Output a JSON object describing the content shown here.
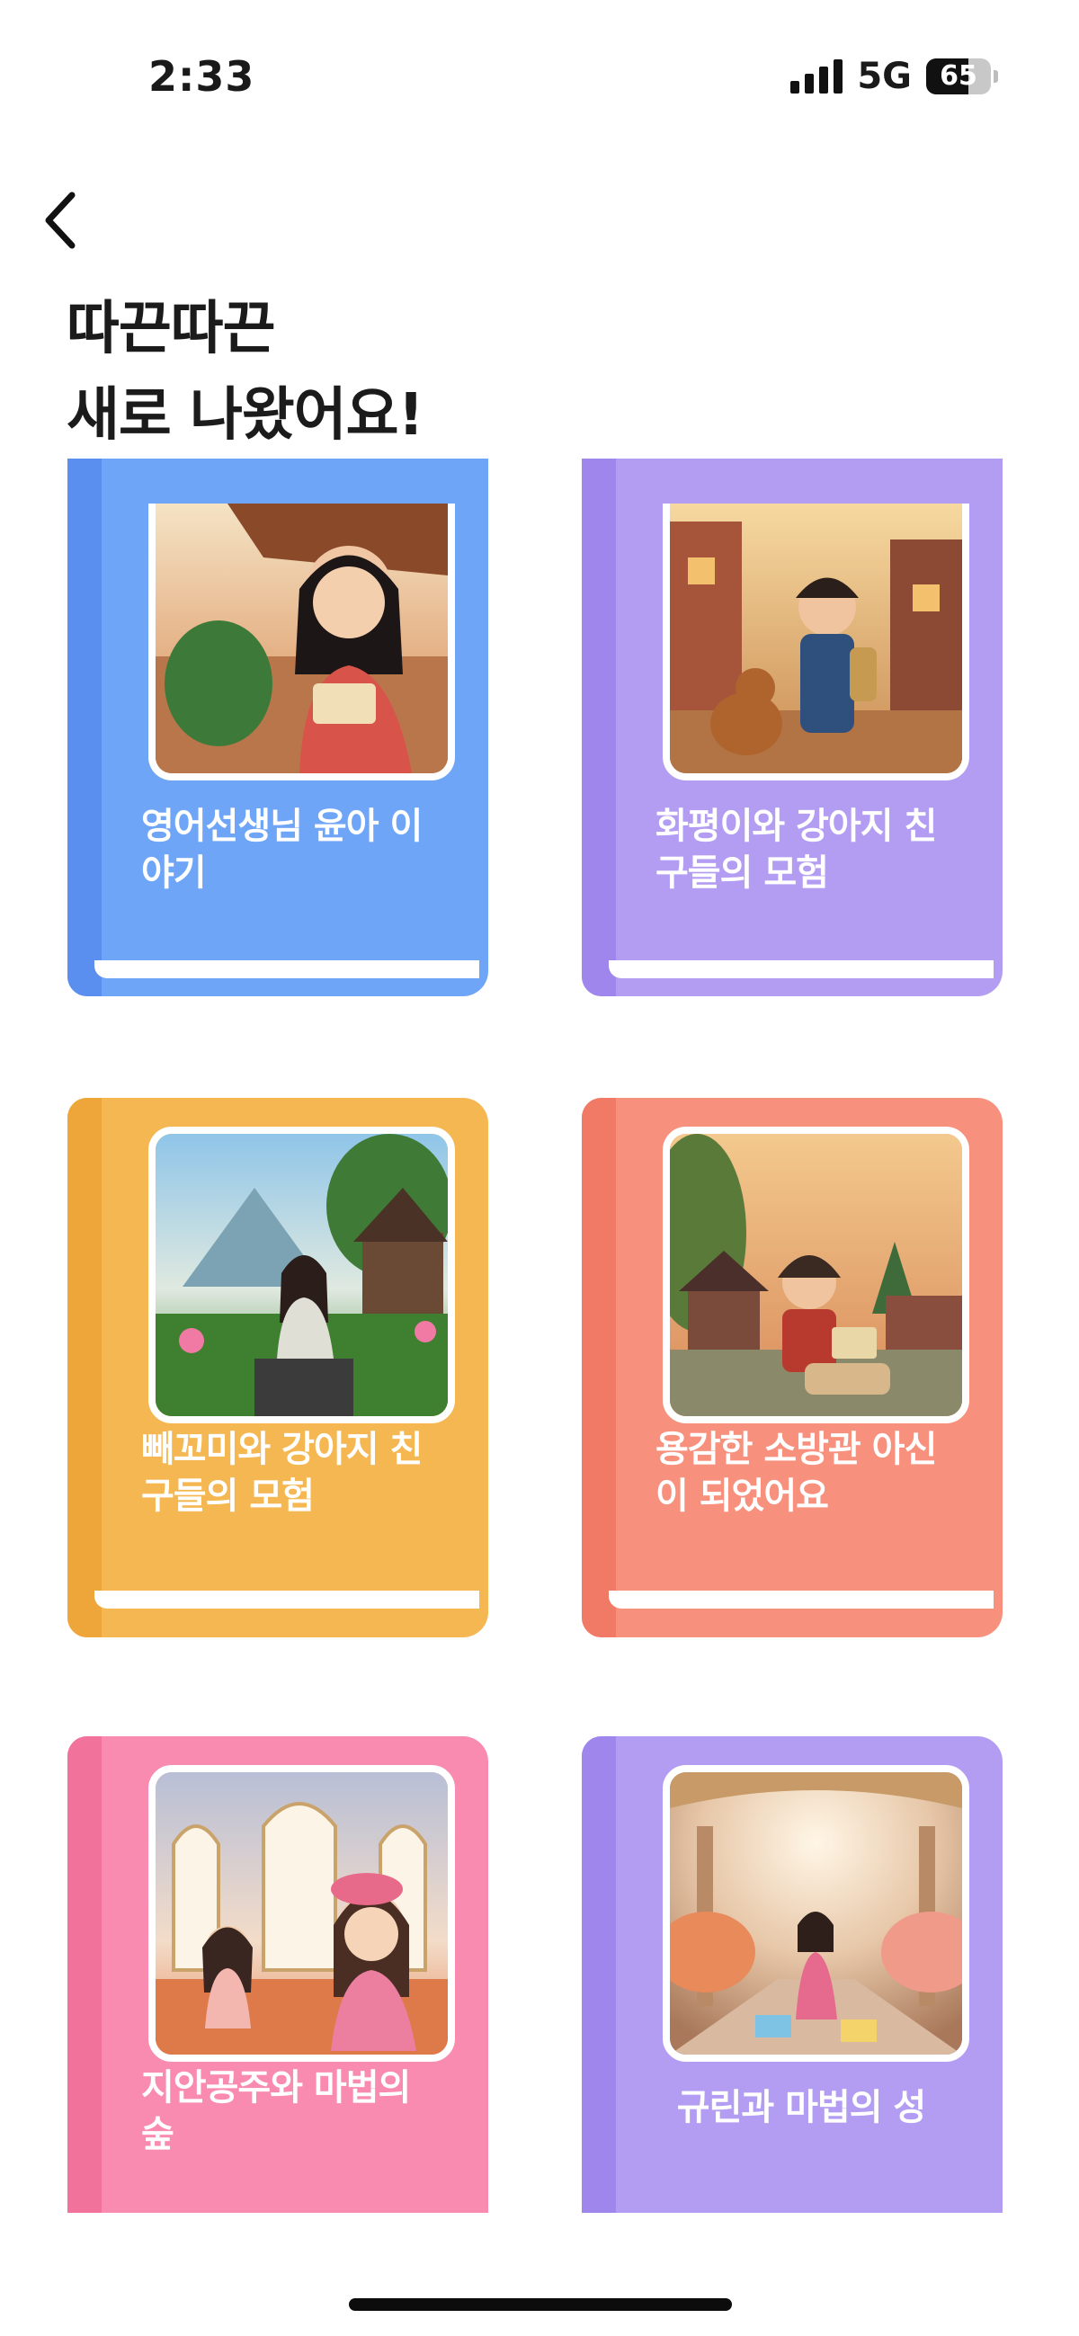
{
  "status": {
    "time": "2:33",
    "network": "5G",
    "battery": "65",
    "battery_level": 0.65
  },
  "header": {
    "title_line1": "따끈따끈",
    "title_line2": "새로 나왔어요!"
  },
  "books": [
    {
      "title": "영어선생님 윤아 이야기",
      "color": "#6fa5f7",
      "spine": "#5a8ff0"
    },
    {
      "title": "화평이와 강아지 친구들의 모험",
      "color": "#b39df3",
      "spine": "#9f86ed"
    },
    {
      "title": "빼꼬미와 강아지 친구들의 모험",
      "color": "#f5b752",
      "spine": "#eea63a"
    },
    {
      "title": "용감한 소방관 아신이 되었어요",
      "color": "#f7907c",
      "spine": "#f17a66"
    },
    {
      "title": "지안공주와 마법의 숲",
      "color": "#f98bb0",
      "spine": "#f1739c"
    },
    {
      "title": "규린과 마법의 성",
      "color": "#b39df3",
      "spine": "#9f86ed"
    }
  ]
}
